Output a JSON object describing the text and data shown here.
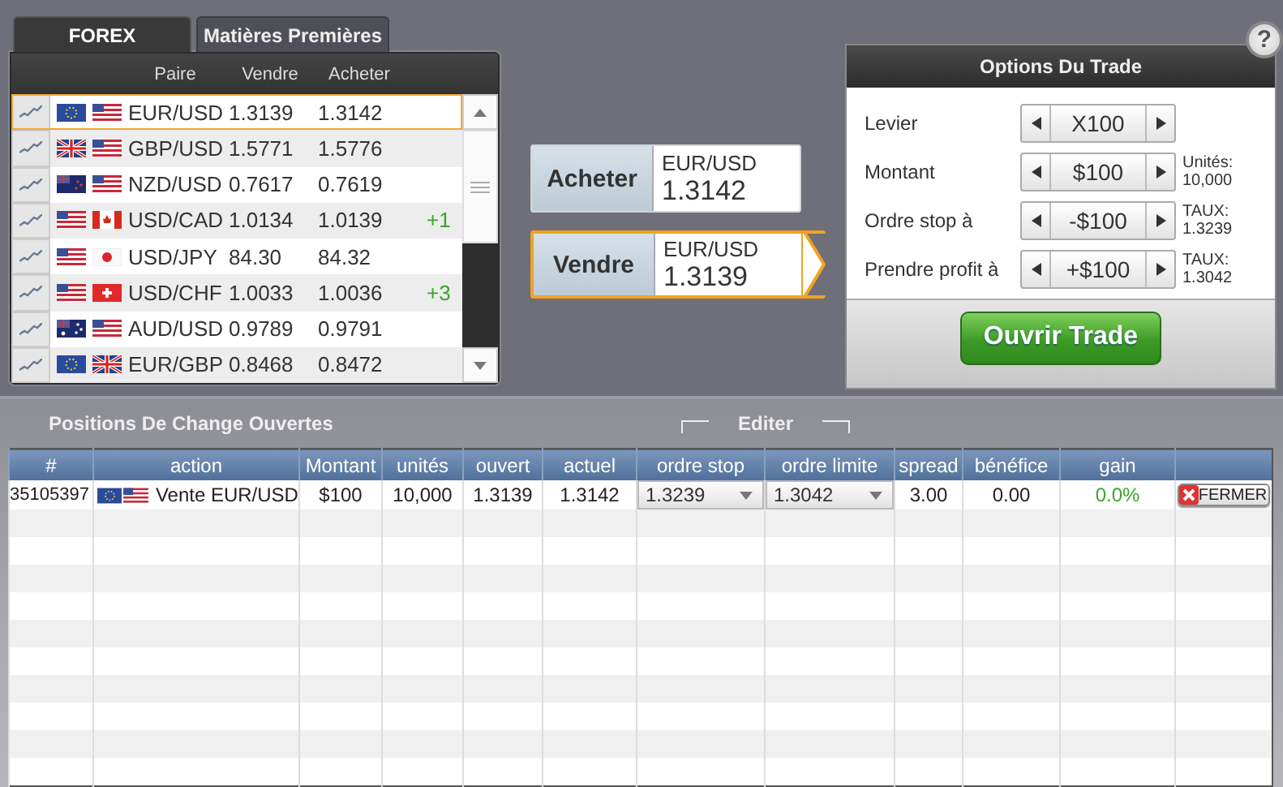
{
  "tabs": [
    {
      "label": "FOREX",
      "selected": true
    },
    {
      "label": "Matières Premières",
      "selected": false
    }
  ],
  "pairs": {
    "columns": [
      "Paire",
      "Vendre",
      "Acheter"
    ],
    "rows": [
      {
        "flags": [
          {
            "kind": "eu"
          },
          {
            "kind": "us"
          }
        ],
        "pair": "EUR/USD",
        "sell": "1.3139",
        "buy": "1.3142",
        "selected": true
      },
      {
        "flags": [
          {
            "kind": "gb"
          },
          {
            "kind": "us"
          }
        ],
        "pair": "GBP/USD",
        "sell": "1.5771",
        "buy": "1.5776",
        "selected": false
      },
      {
        "flags": [
          {
            "kind": "nz"
          },
          {
            "kind": "us"
          }
        ],
        "pair": "NZD/USD",
        "sell": "0.7617",
        "buy": "0.7619",
        "selected": false
      },
      {
        "flags": [
          {
            "kind": "us"
          },
          {
            "kind": "ca"
          }
        ],
        "pair": "USD/CAD",
        "sell": "1.0134",
        "buy": "1.0139",
        "change": "+1",
        "selected": false
      },
      {
        "flags": [
          {
            "kind": "us"
          },
          {
            "kind": "jp"
          }
        ],
        "pair": "USD/JPY",
        "sell": "84.30",
        "buy": "84.32",
        "selected": false
      },
      {
        "flags": [
          {
            "kind": "us"
          },
          {
            "kind": "ch"
          }
        ],
        "pair": "USD/CHF",
        "sell": "1.0033",
        "buy": "1.0036",
        "change": "+3",
        "selected": false
      },
      {
        "flags": [
          {
            "kind": "au"
          },
          {
            "kind": "us"
          }
        ],
        "pair": "AUD/USD",
        "sell": "0.9789",
        "buy": "0.9791",
        "selected": false
      },
      {
        "flags": [
          {
            "kind": "eu"
          },
          {
            "kind": "gb"
          }
        ],
        "pair": "EUR/GBP",
        "sell": "0.8468",
        "buy": "0.8472",
        "selected": false
      }
    ]
  },
  "trade_buttons": [
    {
      "label": "Acheter",
      "pair": "EUR/USD",
      "price": "1.3142",
      "selected": false
    },
    {
      "label": "Vendre",
      "pair": "EUR/USD",
      "price": "1.3139",
      "selected": true
    }
  ],
  "options": {
    "title": "Options Du Trade",
    "help": "?",
    "fields": [
      {
        "label": "Levier",
        "value": "X100"
      },
      {
        "label": "Montant",
        "value": "$100",
        "note_label": "Unités:",
        "note_value": "10,000"
      },
      {
        "label": "Ordre stop à",
        "value": "-$100",
        "note_label": "TAUX:",
        "note_value": "1.3239"
      },
      {
        "label": "Prendre profit à",
        "value": "+$100",
        "note_label": "TAUX:",
        "note_value": "1.3042"
      }
    ],
    "submit": "Ouvrir Trade"
  },
  "positions": {
    "title": "Positions De Change Ouvertes",
    "edit_label": "Editer",
    "columns": [
      "#",
      "action",
      "Montant",
      "unités",
      "ouvert",
      "actuel",
      "ordre stop",
      "ordre limite",
      "spread",
      "bénéfice",
      "gain"
    ],
    "rows": [
      {
        "id": "35105397",
        "flags": [
          {
            "kind": "eu"
          },
          {
            "kind": "us"
          }
        ],
        "action": "Vente EUR/USD",
        "amount": "$100",
        "units": "10,000",
        "open": "1.3139",
        "current": "1.3142",
        "stop": "1.3239",
        "limit": "1.3042",
        "spread": "3.00",
        "profit": "0.00",
        "gain": "0.0%",
        "close": "FERMER"
      }
    ]
  }
}
